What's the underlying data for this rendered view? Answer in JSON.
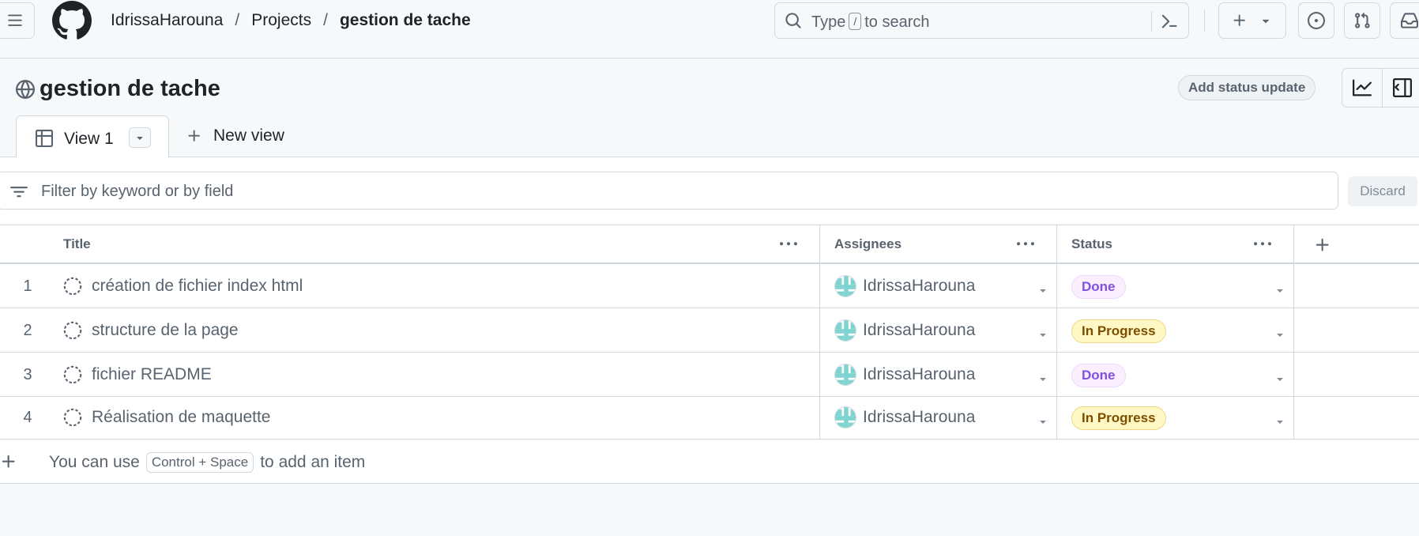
{
  "header": {
    "breadcrumbs": [
      {
        "label": "IdrissaHarouna"
      },
      {
        "label": "Projects"
      },
      {
        "label": "gestion de tache"
      }
    ],
    "search": {
      "prefix": "Type",
      "key": "/",
      "suffix": "to search"
    }
  },
  "project": {
    "title": "gestion de tache",
    "status_update_label": "Add status update"
  },
  "tabs": {
    "active_label": "View 1",
    "new_view_label": "New view"
  },
  "filter": {
    "placeholder": "Filter by keyword or by field",
    "discard_label": "Discard"
  },
  "table": {
    "columns": [
      {
        "label": "Title"
      },
      {
        "label": "Assignees"
      },
      {
        "label": "Status"
      }
    ],
    "rows": [
      {
        "num": "1",
        "title": "création de fichier index html",
        "assignee": "IdrissaHarouna",
        "status": "Done"
      },
      {
        "num": "2",
        "title": "structure de la page",
        "assignee": "IdrissaHarouna",
        "status": "In Progress"
      },
      {
        "num": "3",
        "title": "fichier README",
        "assignee": "IdrissaHarouna",
        "status": "Done"
      },
      {
        "num": "4",
        "title": "Réalisation de maquette",
        "assignee": "IdrissaHarouna",
        "status": "In Progress"
      }
    ],
    "add_item": {
      "before": "You can use",
      "shortcut": "Control + Space",
      "after": "to add an item"
    }
  },
  "colors": {
    "done_text": "#8250df",
    "in_progress_text": "#7d4e00",
    "border": "#d1d9e0"
  },
  "icons": [
    "hamburger-icon",
    "github-logo-icon",
    "search-icon",
    "command-palette-icon",
    "plus-icon",
    "triangle-down-icon",
    "issue-opened-icon",
    "git-pull-request-icon",
    "inbox-icon",
    "globe-icon",
    "graph-icon",
    "sidebar-icon",
    "table-icon",
    "filter-icon",
    "kebab-horizontal-icon",
    "issue-draft-icon"
  ]
}
